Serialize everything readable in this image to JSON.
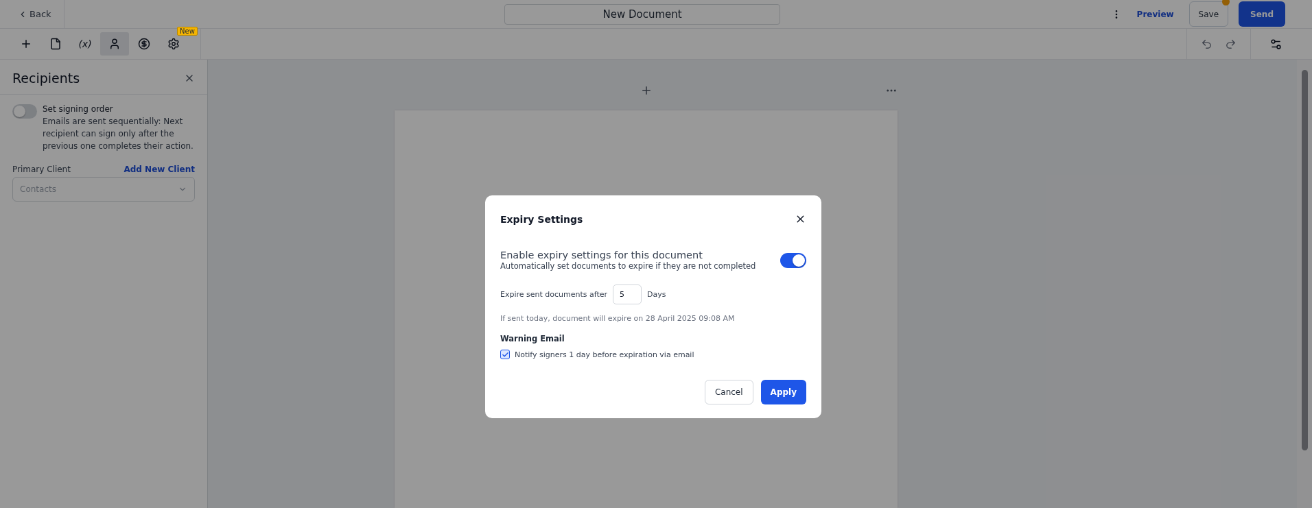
{
  "header": {
    "back": "Back",
    "title": "New Document",
    "preview": "Preview",
    "save": "Save",
    "unsaved": true,
    "send": "Send"
  },
  "toolbar": {
    "tools": [
      {
        "kind": "add",
        "selected": false
      },
      {
        "kind": "document",
        "selected": false
      },
      {
        "kind": "text",
        "label": "(x)",
        "selected": false
      },
      {
        "kind": "person",
        "selected": true
      },
      {
        "kind": "dollar",
        "selected": false
      },
      {
        "kind": "gear",
        "selected": false,
        "badge": "New"
      }
    ]
  },
  "sidebar": {
    "title": "Recipients",
    "signing_order": {
      "label": "Set signing order",
      "description": "Emails are sent sequentially: Next recipient can sign only after the previous one completes their action.",
      "on": false
    },
    "primary_client": {
      "label": "Primary Client",
      "link": "Add New Client",
      "placeholder": "Contacts"
    }
  },
  "dialog": {
    "title": "Expiry Settings",
    "enable": {
      "title": "Enable expiry settings for this document",
      "description": "Automatically set documents to expire if they are not completed",
      "on": true
    },
    "expire_label": "Expire sent documents after",
    "days_value": "5",
    "days_unit": "Days",
    "note": "If sent today, document will expire on 28 April 2025 09:08 AM",
    "warning_heading": "Warning Email",
    "notify": {
      "label": "Notify signers 1 day before expiration via email",
      "checked": true
    },
    "buttons": [
      {
        "label": "Cancel",
        "kind": "secondary"
      },
      {
        "label": "Apply",
        "kind": "primary"
      }
    ]
  }
}
